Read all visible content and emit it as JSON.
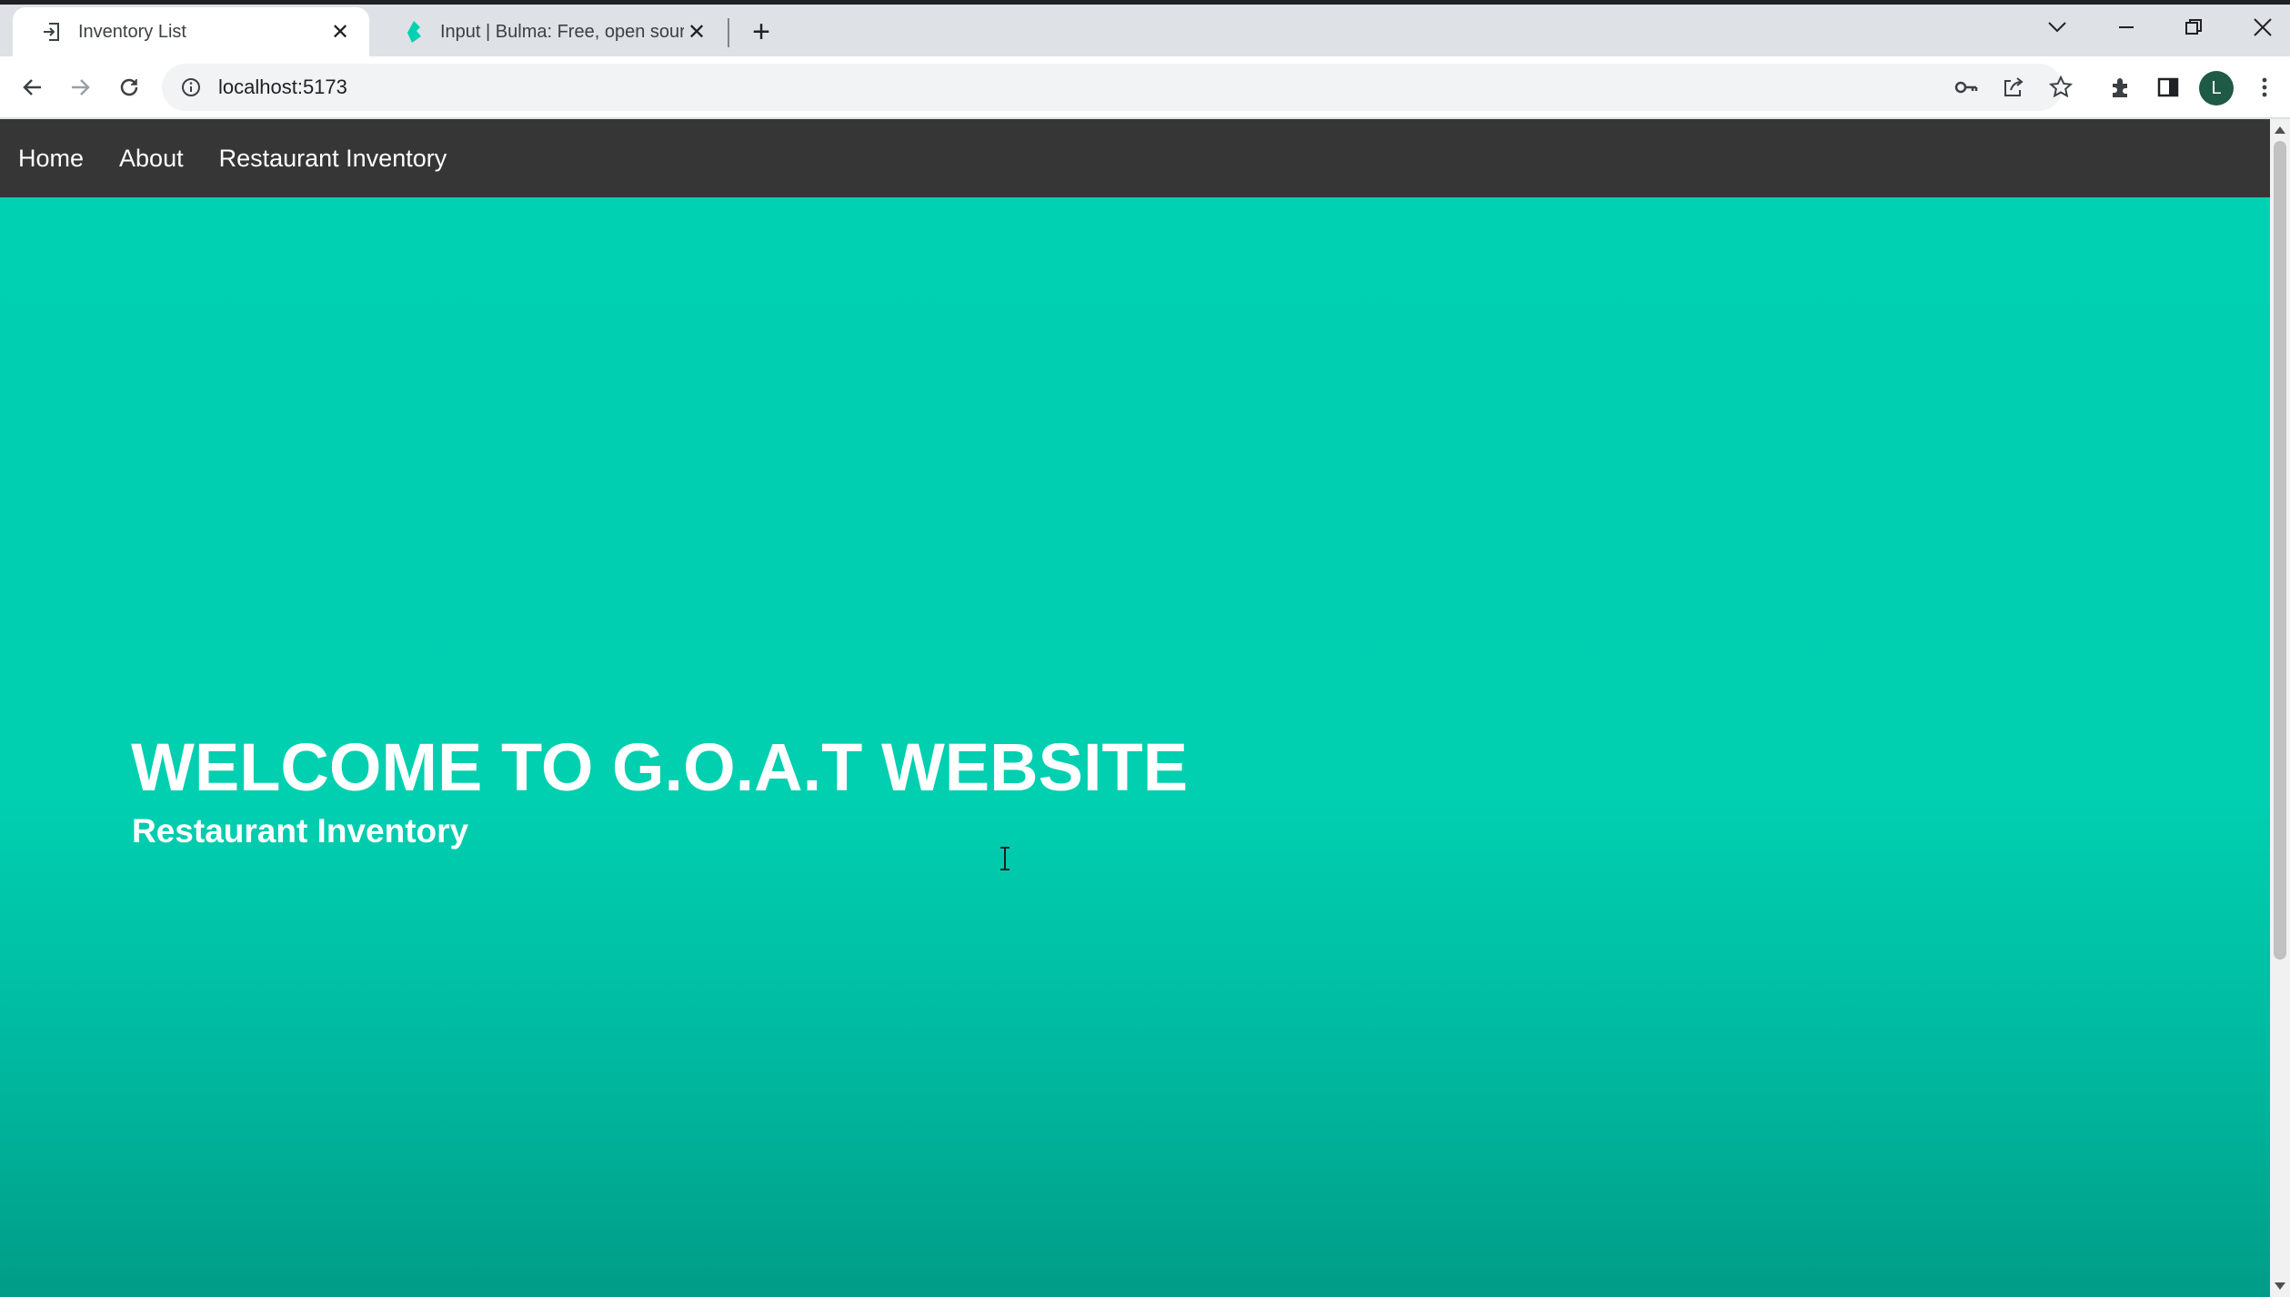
{
  "browser": {
    "tabs": [
      {
        "title": "Inventory List",
        "icon": "login-icon",
        "active": true
      },
      {
        "title": "Input | Bulma: Free, open source",
        "icon": "bulma-icon",
        "active": false
      }
    ],
    "url": "localhost:5173",
    "profile_initial": "L"
  },
  "nav": {
    "items": [
      "Home",
      "About",
      "Restaurant Inventory"
    ]
  },
  "hero": {
    "title": "WELCOME TO G.O.A.T WEBSITE",
    "subtitle": "Restaurant Inventory"
  },
  "colors": {
    "primary": "#00d1b2",
    "navbar": "#363636"
  }
}
